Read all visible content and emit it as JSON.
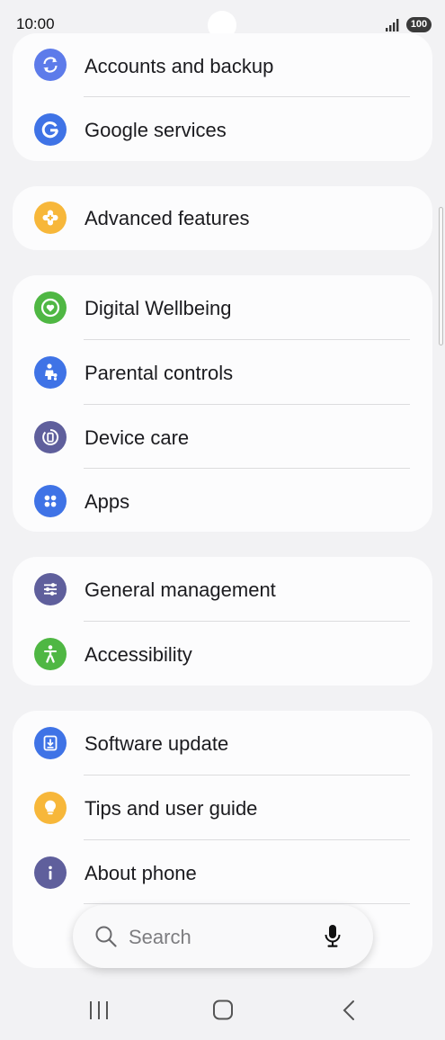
{
  "status_bar": {
    "time": "10:00",
    "battery": "100"
  },
  "groups": [
    {
      "items": [
        {
          "label": "Accounts and backup",
          "icon": "sync-icon",
          "color": "#5d7bea"
        },
        {
          "label": "Google services",
          "icon": "google-icon",
          "color": "#3f73e6"
        }
      ]
    },
    {
      "items": [
        {
          "label": "Advanced features",
          "icon": "gear-plus-icon",
          "color": "#f7b73a"
        }
      ]
    },
    {
      "items": [
        {
          "label": "Digital Wellbeing",
          "icon": "heart-ring-icon",
          "color": "#4fb743"
        },
        {
          "label": "Parental controls",
          "icon": "parent-child-icon",
          "color": "#3f73e6"
        },
        {
          "label": "Device care",
          "icon": "device-care-icon",
          "color": "#5f5f9c"
        },
        {
          "label": "Apps",
          "icon": "apps-grid-icon",
          "color": "#3f73e6"
        }
      ]
    },
    {
      "items": [
        {
          "label": "General management",
          "icon": "sliders-icon",
          "color": "#5f5f9c"
        },
        {
          "label": "Accessibility",
          "icon": "accessibility-person-icon",
          "color": "#4fb743"
        }
      ]
    },
    {
      "items": [
        {
          "label": "Software update",
          "icon": "download-icon",
          "color": "#3f73e6"
        },
        {
          "label": "Tips and user guide",
          "icon": "lightbulb-icon",
          "color": "#f7b73a"
        },
        {
          "label": "About phone",
          "icon": "info-icon",
          "color": "#5f5f9c"
        }
      ]
    }
  ],
  "search": {
    "placeholder": "Search"
  },
  "navigation": {
    "recents": "recents-icon",
    "home": "home-icon",
    "back": "back-icon"
  }
}
